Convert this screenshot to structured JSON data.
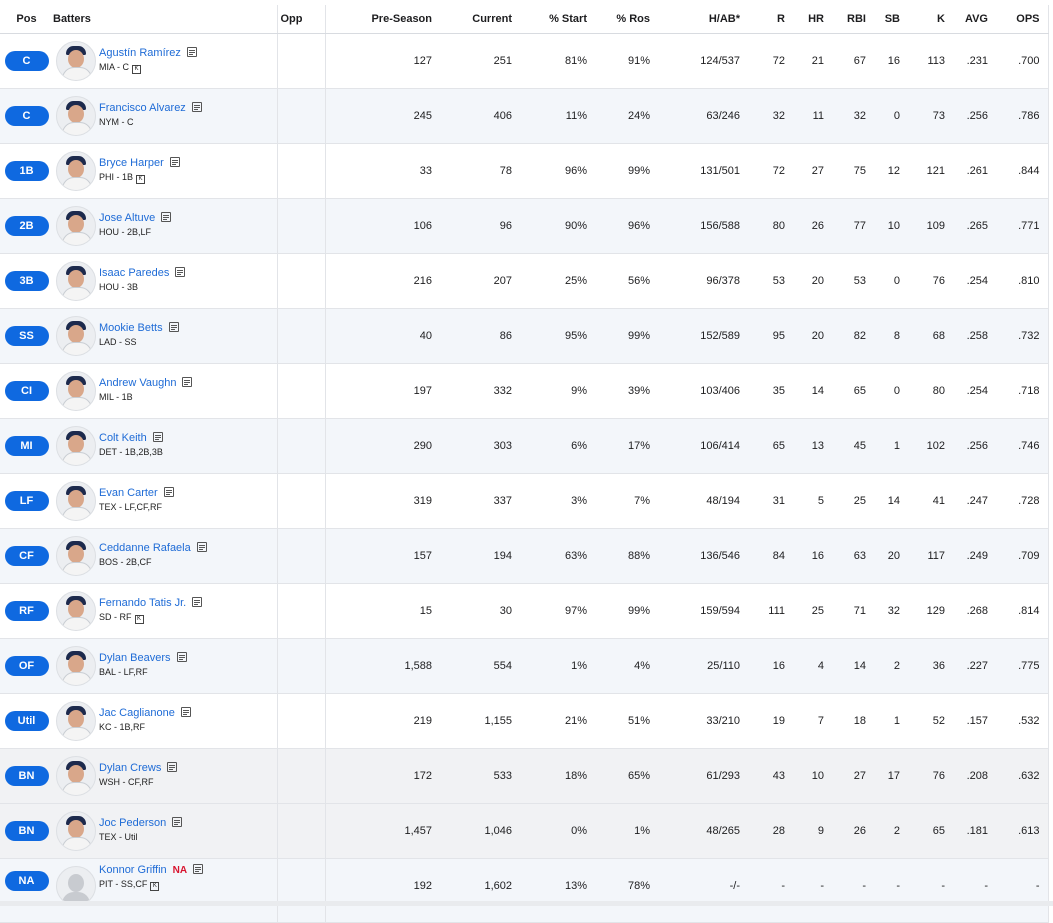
{
  "headers": {
    "pos": "Pos",
    "batters": "Batters",
    "opp": "Opp",
    "preseason": "Pre-Season",
    "current": "Current",
    "start": "% Start",
    "ros": "% Ros",
    "hab": "H/AB*",
    "r": "R",
    "hr": "HR",
    "rbi": "RBI",
    "sb": "SB",
    "k": "K",
    "avg": "AVG",
    "ops": "OPS"
  },
  "colors": {
    "accent": "#0f69e0",
    "link": "#1e6bd6",
    "na": "#d8142f"
  },
  "rows": [
    {
      "pos": "C",
      "name": "Agustín Ramírez",
      "meta": "MIA - C",
      "k_badge": "K",
      "pre": "127",
      "cur": "251",
      "start": "81%",
      "ros": "91%",
      "hab": "124/537",
      "r": "72",
      "hr": "21",
      "rbi": "67",
      "sb": "16",
      "k": "113",
      "avg": ".231",
      "ops": ".700"
    },
    {
      "pos": "C",
      "name": "Francisco Alvarez",
      "meta": "NYM - C",
      "pre": "245",
      "cur": "406",
      "start": "11%",
      "ros": "24%",
      "hab": "63/246",
      "r": "32",
      "hr": "11",
      "rbi": "32",
      "sb": "0",
      "k": "73",
      "avg": ".256",
      "ops": ".786"
    },
    {
      "pos": "1B",
      "name": "Bryce Harper",
      "meta": "PHI - 1B",
      "k_badge": "K",
      "pre": "33",
      "cur": "78",
      "start": "96%",
      "ros": "99%",
      "hab": "131/501",
      "r": "72",
      "hr": "27",
      "rbi": "75",
      "sb": "12",
      "k": "121",
      "avg": ".261",
      "ops": ".844"
    },
    {
      "pos": "2B",
      "name": "Jose Altuve",
      "meta": "HOU - 2B,LF",
      "pre": "106",
      "cur": "96",
      "start": "90%",
      "ros": "96%",
      "hab": "156/588",
      "r": "80",
      "hr": "26",
      "rbi": "77",
      "sb": "10",
      "k": "109",
      "avg": ".265",
      "ops": ".771"
    },
    {
      "pos": "3B",
      "name": "Isaac Paredes",
      "meta": "HOU - 3B",
      "pre": "216",
      "cur": "207",
      "start": "25%",
      "ros": "56%",
      "hab": "96/378",
      "r": "53",
      "hr": "20",
      "rbi": "53",
      "sb": "0",
      "k": "76",
      "avg": ".254",
      "ops": ".810"
    },
    {
      "pos": "SS",
      "name": "Mookie Betts",
      "meta": "LAD - SS",
      "pre": "40",
      "cur": "86",
      "start": "95%",
      "ros": "99%",
      "hab": "152/589",
      "r": "95",
      "hr": "20",
      "rbi": "82",
      "sb": "8",
      "k": "68",
      "avg": ".258",
      "ops": ".732"
    },
    {
      "pos": "CI",
      "name": "Andrew Vaughn",
      "meta": "MIL - 1B",
      "pre": "197",
      "cur": "332",
      "start": "9%",
      "ros": "39%",
      "hab": "103/406",
      "r": "35",
      "hr": "14",
      "rbi": "65",
      "sb": "0",
      "k": "80",
      "avg": ".254",
      "ops": ".718"
    },
    {
      "pos": "MI",
      "name": "Colt Keith",
      "meta": "DET - 1B,2B,3B",
      "pre": "290",
      "cur": "303",
      "start": "6%",
      "ros": "17%",
      "hab": "106/414",
      "r": "65",
      "hr": "13",
      "rbi": "45",
      "sb": "1",
      "k": "102",
      "avg": ".256",
      "ops": ".746"
    },
    {
      "pos": "LF",
      "name": "Evan Carter",
      "meta": "TEX - LF,CF,RF",
      "pre": "319",
      "cur": "337",
      "start": "3%",
      "ros": "7%",
      "hab": "48/194",
      "r": "31",
      "hr": "5",
      "rbi": "25",
      "sb": "14",
      "k": "41",
      "avg": ".247",
      "ops": ".728"
    },
    {
      "pos": "CF",
      "name": "Ceddanne Rafaela",
      "meta": "BOS - 2B,CF",
      "pre": "157",
      "cur": "194",
      "start": "63%",
      "ros": "88%",
      "hab": "136/546",
      "r": "84",
      "hr": "16",
      "rbi": "63",
      "sb": "20",
      "k": "117",
      "avg": ".249",
      "ops": ".709"
    },
    {
      "pos": "RF",
      "name": "Fernando Tatis Jr.",
      "meta": "SD - RF",
      "k_badge": "K",
      "pre": "15",
      "cur": "30",
      "start": "97%",
      "ros": "99%",
      "hab": "159/594",
      "r": "111",
      "hr": "25",
      "rbi": "71",
      "sb": "32",
      "k": "129",
      "avg": ".268",
      "ops": ".814"
    },
    {
      "pos": "OF",
      "name": "Dylan Beavers",
      "meta": "BAL - LF,RF",
      "pre": "1,588",
      "cur": "554",
      "start": "1%",
      "ros": "4%",
      "hab": "25/110",
      "r": "16",
      "hr": "4",
      "rbi": "14",
      "sb": "2",
      "k": "36",
      "avg": ".227",
      "ops": ".775"
    },
    {
      "pos": "Util",
      "name": "Jac Caglianone",
      "meta": "KC - 1B,RF",
      "pre": "219",
      "cur": "1,155",
      "start": "21%",
      "ros": "51%",
      "hab": "33/210",
      "r": "19",
      "hr": "7",
      "rbi": "18",
      "sb": "1",
      "k": "52",
      "avg": ".157",
      "ops": ".532"
    },
    {
      "pos": "BN",
      "name": "Dylan Crews",
      "meta": "WSH - CF,RF",
      "pre": "172",
      "cur": "533",
      "start": "18%",
      "ros": "65%",
      "hab": "61/293",
      "r": "43",
      "hr": "10",
      "rbi": "27",
      "sb": "17",
      "k": "76",
      "avg": ".208",
      "ops": ".632"
    },
    {
      "pos": "BN",
      "name": "Joc Pederson",
      "meta": "TEX - Util",
      "pre": "1,457",
      "cur": "1,046",
      "start": "0%",
      "ros": "1%",
      "hab": "48/265",
      "r": "28",
      "hr": "9",
      "rbi": "26",
      "sb": "2",
      "k": "65",
      "avg": ".181",
      "ops": ".613"
    },
    {
      "pos": "NA",
      "name": "Konnor Griffin",
      "na_tag": "NA",
      "meta": "PIT - SS,CF",
      "k_badge": "K",
      "pre": "192",
      "cur": "1,602",
      "start": "13%",
      "ros": "78%",
      "hab": "-/-",
      "r": "-",
      "hr": "-",
      "rbi": "-",
      "sb": "-",
      "k": "-",
      "avg": "-",
      "ops": "-"
    }
  ]
}
